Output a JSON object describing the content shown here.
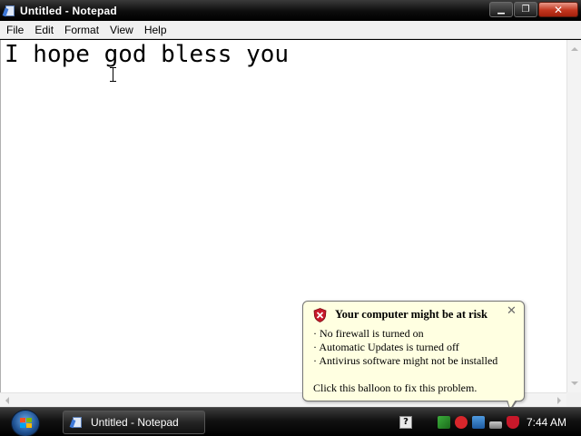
{
  "window": {
    "title": "Untitled - Notepad",
    "controls": {
      "minimize": "▁",
      "maximize": "❐",
      "close": "✕"
    }
  },
  "menu": {
    "items": [
      "File",
      "Edit",
      "Format",
      "View",
      "Help"
    ]
  },
  "editor": {
    "text": "I hope god bless you"
  },
  "balloon": {
    "title": "Your computer might be at risk",
    "close_glyph": "✕",
    "lines": [
      "· No firewall is turned on",
      "· Automatic Updates is turned off",
      "· Antivirus software might not be installed"
    ],
    "footer": "Click this balloon to fix this problem.",
    "icon": "security-shield-icon"
  },
  "taskbar": {
    "task_label": "Untitled - Notepad",
    "help_glyph": "?",
    "tray_icons": [
      "network-icon",
      "security-alert-icon",
      "app-icon",
      "volume-icon",
      "security-center-icon"
    ],
    "clock": "7:44 AM"
  },
  "colors": {
    "balloon_bg": "#ffffe1",
    "close_red": "#c2361e",
    "shield_red": "#c8182a"
  }
}
